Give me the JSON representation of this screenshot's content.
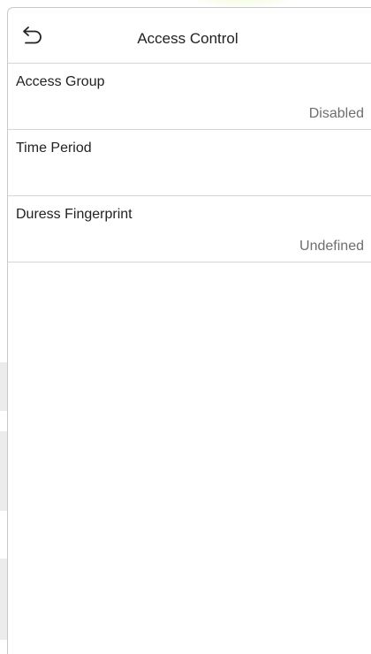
{
  "header": {
    "title": "Access Control",
    "back_icon": "back-arrow-icon"
  },
  "menu": {
    "items": [
      {
        "label": "Access Group",
        "value": "Disabled"
      },
      {
        "label": "Time Period",
        "value": ""
      },
      {
        "label": "Duress Fingerprint",
        "value": "Undefined"
      }
    ]
  },
  "colors": {
    "divider": "#d5d5d5",
    "value_text": "#6e6e6e",
    "label_text": "#222222"
  }
}
